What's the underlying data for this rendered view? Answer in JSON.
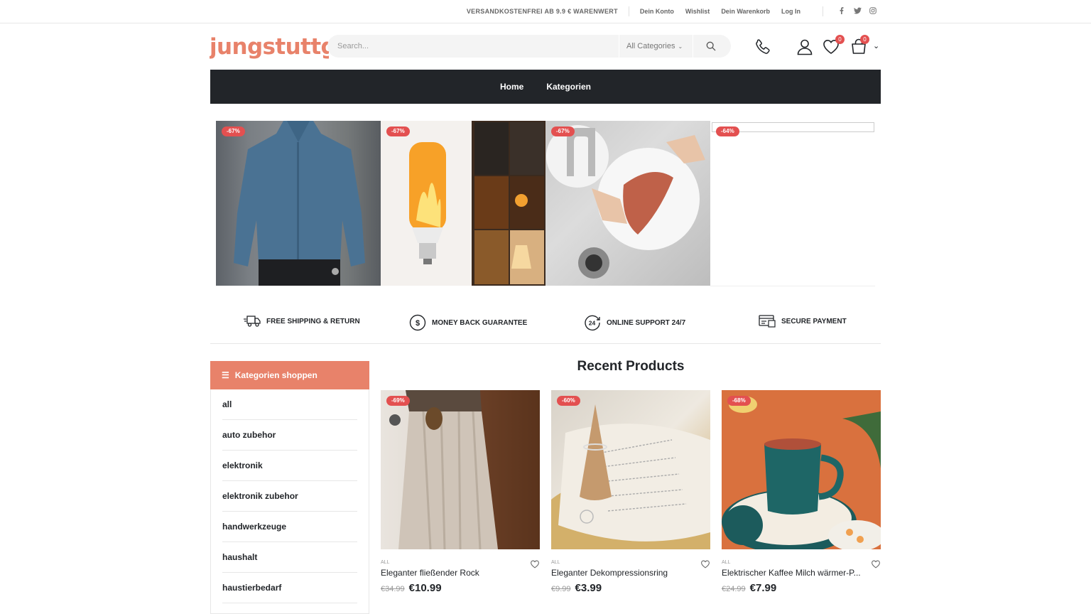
{
  "topbar": {
    "shipping_note": "VERSANDKOSTENFREI AB 9.9 € WARENWERT",
    "links": [
      "Dein Konto",
      "Wishlist",
      "Dein Warenkorb",
      "Log In"
    ],
    "social": [
      "facebook-icon",
      "twitter-icon",
      "instagram-icon"
    ]
  },
  "header": {
    "logo_text": "jungstuttgart",
    "search": {
      "placeholder": "Search...",
      "category": "All Categories"
    },
    "wishlist_count": "0",
    "cart_count": "0"
  },
  "nav": {
    "items": [
      "Home",
      "Kategorien"
    ]
  },
  "banner": {
    "tiles": [
      {
        "discount": "-67%"
      },
      {
        "discount": "-67%"
      },
      {
        "discount": "-67%"
      },
      {
        "discount": "-64%"
      }
    ]
  },
  "features": [
    {
      "label": "FREE SHIPPING & RETURN",
      "icon": "truck-icon"
    },
    {
      "label": "MONEY BACK GUARANTEE",
      "icon": "dollar-icon"
    },
    {
      "label": "ONLINE SUPPORT 24/7",
      "icon": "support-24-icon"
    },
    {
      "label": "SECURE PAYMENT",
      "icon": "payment-icon"
    }
  ],
  "sidebar": {
    "title": "Kategorien shoppen",
    "items": [
      "all",
      "auto zubehor",
      "elektronik",
      "elektronik zubehor",
      "handwerkzeuge",
      "haushalt",
      "haustierbedarf"
    ]
  },
  "recent": {
    "title": "Recent Products",
    "products": [
      {
        "discount": "-69%",
        "category": "ALL",
        "name": "Eleganter fließender Rock",
        "old_price": "€34.99",
        "price": "€10.99"
      },
      {
        "discount": "-60%",
        "category": "ALL",
        "name": "Eleganter Dekompressionsring",
        "old_price": "€9.99",
        "price": "€3.99"
      },
      {
        "discount": "-68%",
        "category": "ALL",
        "name": "Elektrischer Kaffee Milch wärmer-P...",
        "old_price": "€24.99",
        "price": "€7.99"
      }
    ]
  },
  "colors": {
    "accent": "#e8826a",
    "nav_bg": "#222529",
    "badge": "#e35050"
  }
}
